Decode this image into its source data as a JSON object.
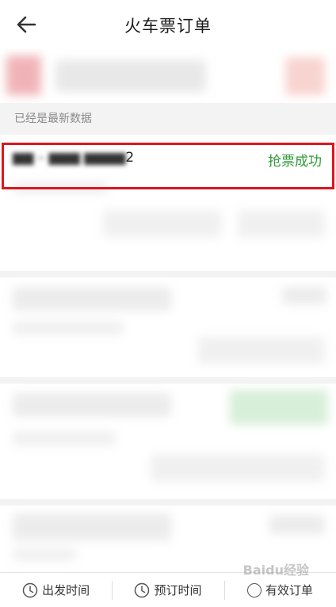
{
  "header": {
    "title": "火车票订单",
    "back_icon": "back-arrow-icon"
  },
  "status_bar": {
    "text": "已经是最新数据"
  },
  "order": {
    "route_visible_suffix": "2",
    "status": "抢票成功",
    "status_color": "#2f9a3a"
  },
  "highlight_color": "#e0141e",
  "bottom_tabs": [
    {
      "label": "出发时间",
      "icon": "clock-icon"
    },
    {
      "label": "预订时间",
      "icon": "clock-icon"
    },
    {
      "label": "有效订单",
      "icon": "circle-icon"
    }
  ],
  "watermark": "Baidu经验"
}
